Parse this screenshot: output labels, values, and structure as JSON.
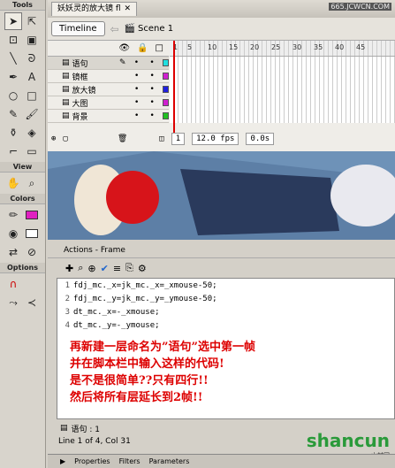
{
  "tools": {
    "header": "Tools",
    "view": "View",
    "colors": "Colors",
    "options": "Options"
  },
  "document": {
    "tab": "妖妖灵的放大镜 fl",
    "watermark": "665.JCWCN.COM"
  },
  "timeline": {
    "button": "Timeline",
    "scene": "Scene 1",
    "layers": [
      {
        "name": "语句",
        "color": "#20e0e0"
      },
      {
        "name": "镜框",
        "color": "#d020d0"
      },
      {
        "name": "放大镜",
        "color": "#2020e0"
      },
      {
        "name": "大图",
        "color": "#d020d0"
      },
      {
        "name": "背景",
        "color": "#20c020"
      }
    ],
    "ruler": [
      "1",
      "5",
      "10",
      "15",
      "20",
      "25",
      "30",
      "35",
      "40",
      "45"
    ],
    "frame": "1",
    "fps": "12.0 fps",
    "time": "0.0s"
  },
  "actions": {
    "title": "Actions - Frame",
    "code": [
      "fdj_mc._x=jk_mc._x=_xmouse-50;",
      "fdj_mc._y=jk_mc._y=_ymouse-50;",
      "dt_mc._x=-_xmouse;",
      "dt_mc._y=-_ymouse;"
    ],
    "annotation": [
      "再新建一层命名为”语句”选中第一帧",
      "并在脚本栏中输入这样的代码!",
      "是不是很简单??只有四行!!",
      "然后将所有层延长到2帧!!"
    ],
    "tab": "语句 : 1",
    "status": "Line 1 of 4, Col 31"
  },
  "panels": {
    "properties": "Properties",
    "filters": "Filters",
    "parameters": "Parameters"
  },
  "logo": {
    "text": "shancun",
    "sub": "山村网"
  }
}
